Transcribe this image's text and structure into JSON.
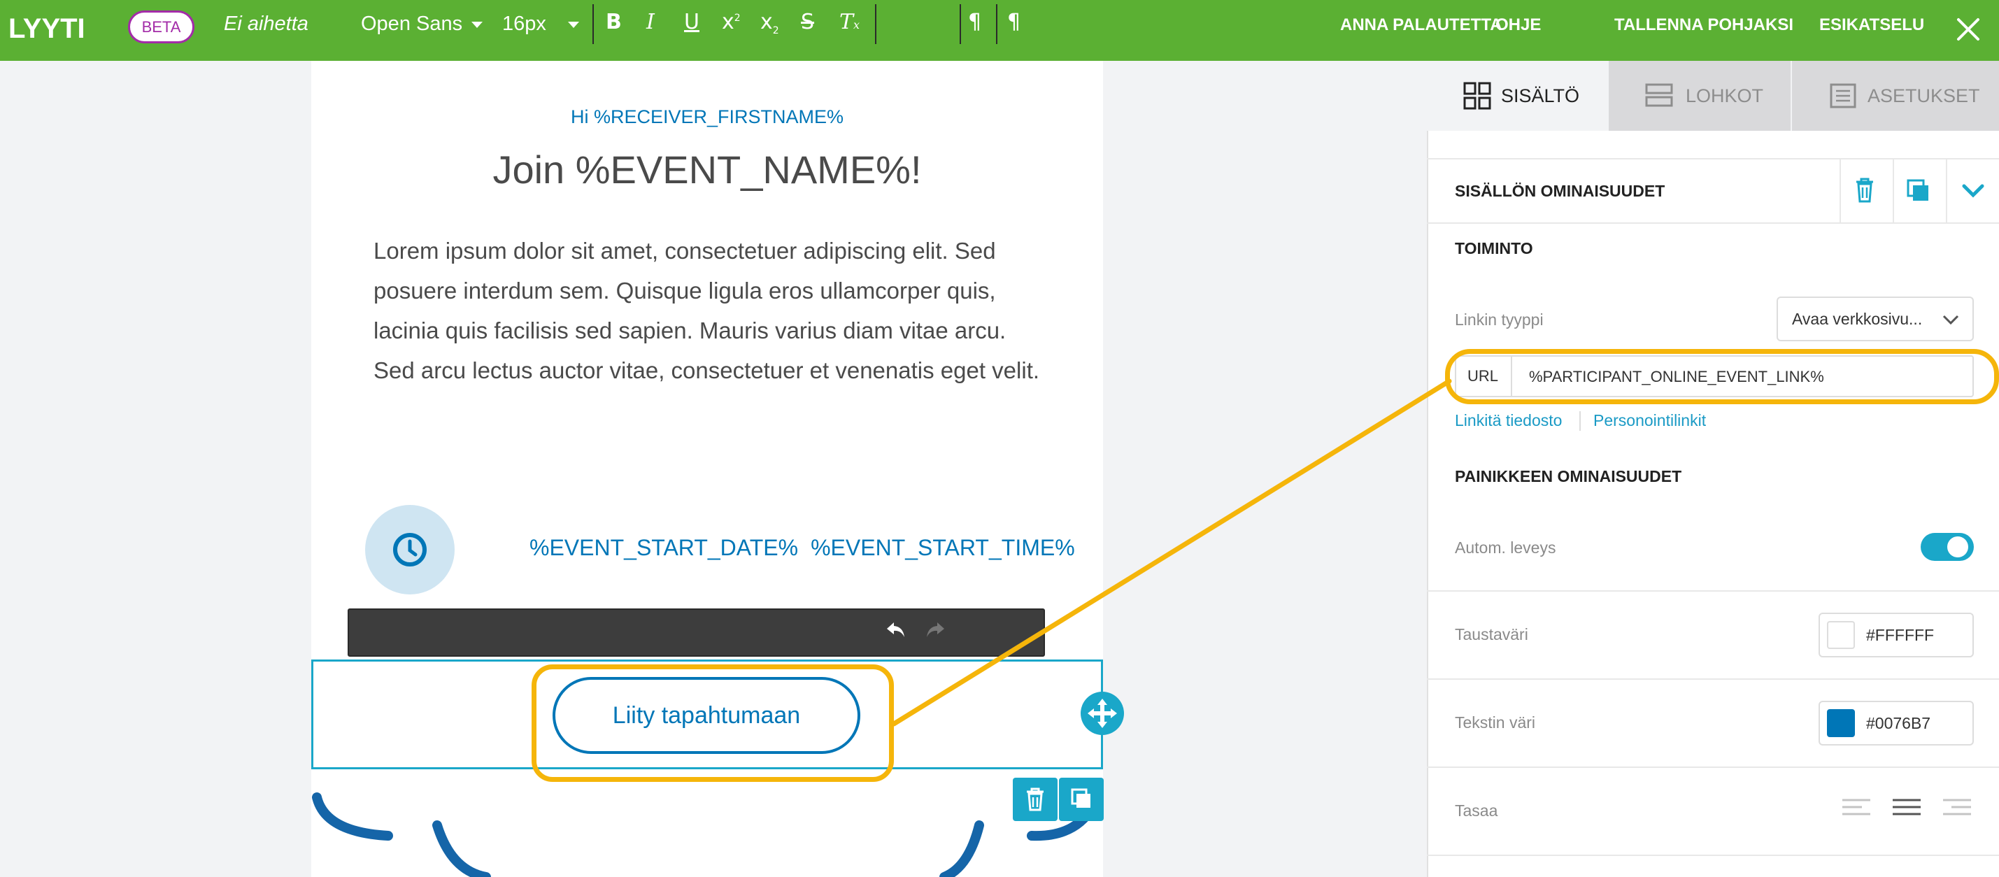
{
  "app": {
    "brand": "LYYTI",
    "beta_label": "BETA",
    "document_title": "Ei aihetta"
  },
  "topnav": [
    {
      "label": "ANNA PALAUTETTA"
    },
    {
      "label": "OHJE"
    },
    {
      "label": "TALLENNA POHJAKSI"
    },
    {
      "label": "ESIKATSELU"
    }
  ],
  "email": {
    "greeting": "Hi %RECEIVER_FIRSTNAME%",
    "headline": "Join %EVENT_NAME%!",
    "body": "Lorem ipsum dolor sit amet, consectetuer adipiscing elit. Sed posuere interdum sem. Quisque ligula eros ullamcorper quis, lacinia quis facilisis sed sapien. Mauris varius diam vitae arcu. Sed arcu lectus auctor vitae, consectetuer et venenatis eget velit.",
    "start_date": "%EVENT_START_DATE%",
    "start_time": "%EVENT_START_TIME%",
    "cta_label": "Liity tapahtumaan"
  },
  "toolbar": {
    "font_family": "Open Sans",
    "font_size": "16px"
  },
  "panel": {
    "tabs": [
      {
        "label": "SISÄLTÖ",
        "active": true
      },
      {
        "label": "LOHKOT",
        "active": false
      },
      {
        "label": "ASETUKSET",
        "active": false
      }
    ],
    "content_props_title": "SISÄLLÖN OMINAISUUDET",
    "action_title": "TOIMINTO",
    "link_type_label": "Linkin tyyppi",
    "link_type_value": "Avaa verkkosivu...",
    "url_label": "URL",
    "url_value": "%PARTICIPANT_ONLINE_EVENT_LINK%",
    "link_file": "Linkitä tiedosto",
    "personalization_links": "Personointilinkit",
    "button_props_title": "PAINIKKEEN OMINAISUUDET",
    "auto_width_label": "Autom. leveys",
    "auto_width_on": true,
    "bg_color_label": "Taustaväri",
    "bg_color_value": "#FFFFFF",
    "text_color_label": "Tekstin väri",
    "text_color_value": "#0076B7",
    "align_label": "Tasaa"
  },
  "colors": {
    "brand_green": "#5bb033",
    "accent_cyan": "#1aa7c9",
    "link_blue": "#0076b7",
    "highlight": "#f5b50a"
  }
}
